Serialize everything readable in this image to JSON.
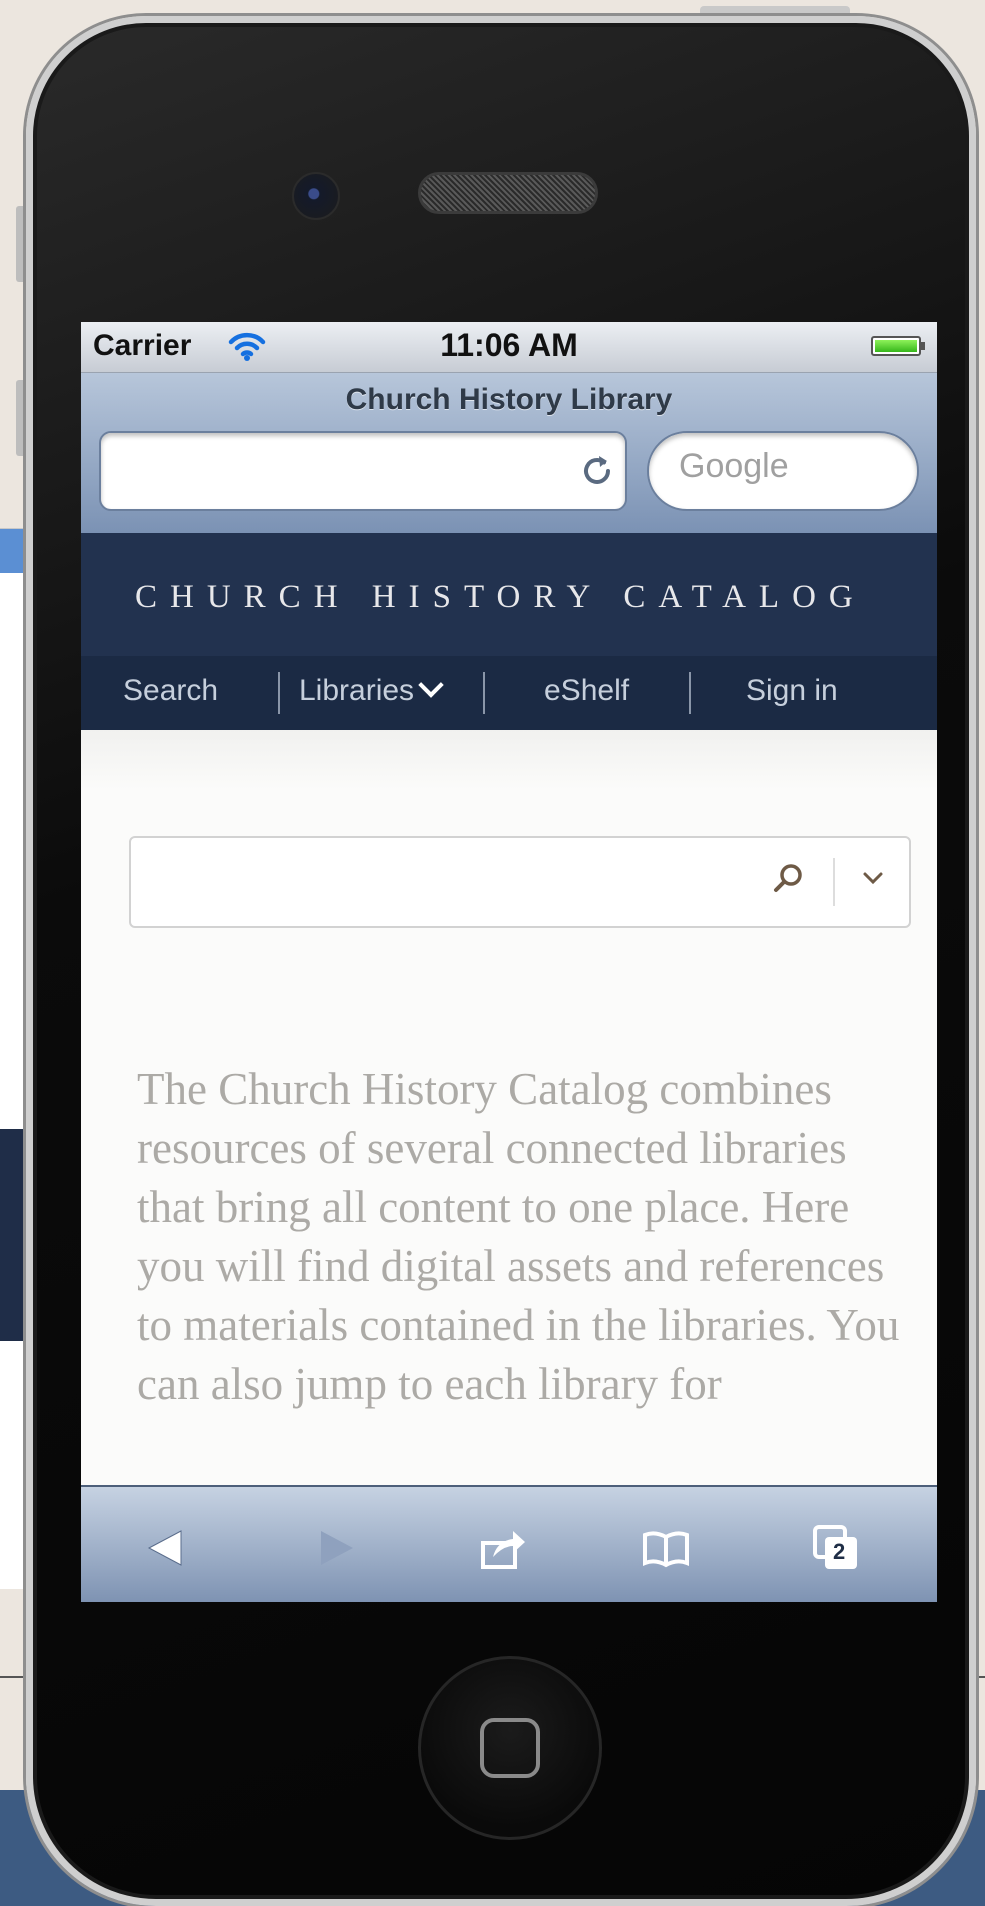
{
  "status_bar": {
    "carrier": "Carrier",
    "time": "11:06 AM"
  },
  "browser": {
    "page_title": "Church History Library",
    "url_value": "",
    "search_placeholder": "Google",
    "tabs_count": "2"
  },
  "site": {
    "catalog_title": "CHURCH HISTORY CATALOG",
    "nav": [
      {
        "label": "Search"
      },
      {
        "label": "Libraries",
        "icon": "chevron-down-icon"
      },
      {
        "label": "eShelf"
      },
      {
        "label": "Sign in"
      }
    ],
    "search": {
      "value": ""
    },
    "description": "The Church History Catalog combines resources of several connected libraries that bring all content to one place. Here you will find digital assets and references to materials contained in the libraries. You can also jump to each library for"
  },
  "colors": {
    "header_bg": "#22324f",
    "nav_bg": "#1b2a44",
    "body_text": "#acaaa6"
  }
}
